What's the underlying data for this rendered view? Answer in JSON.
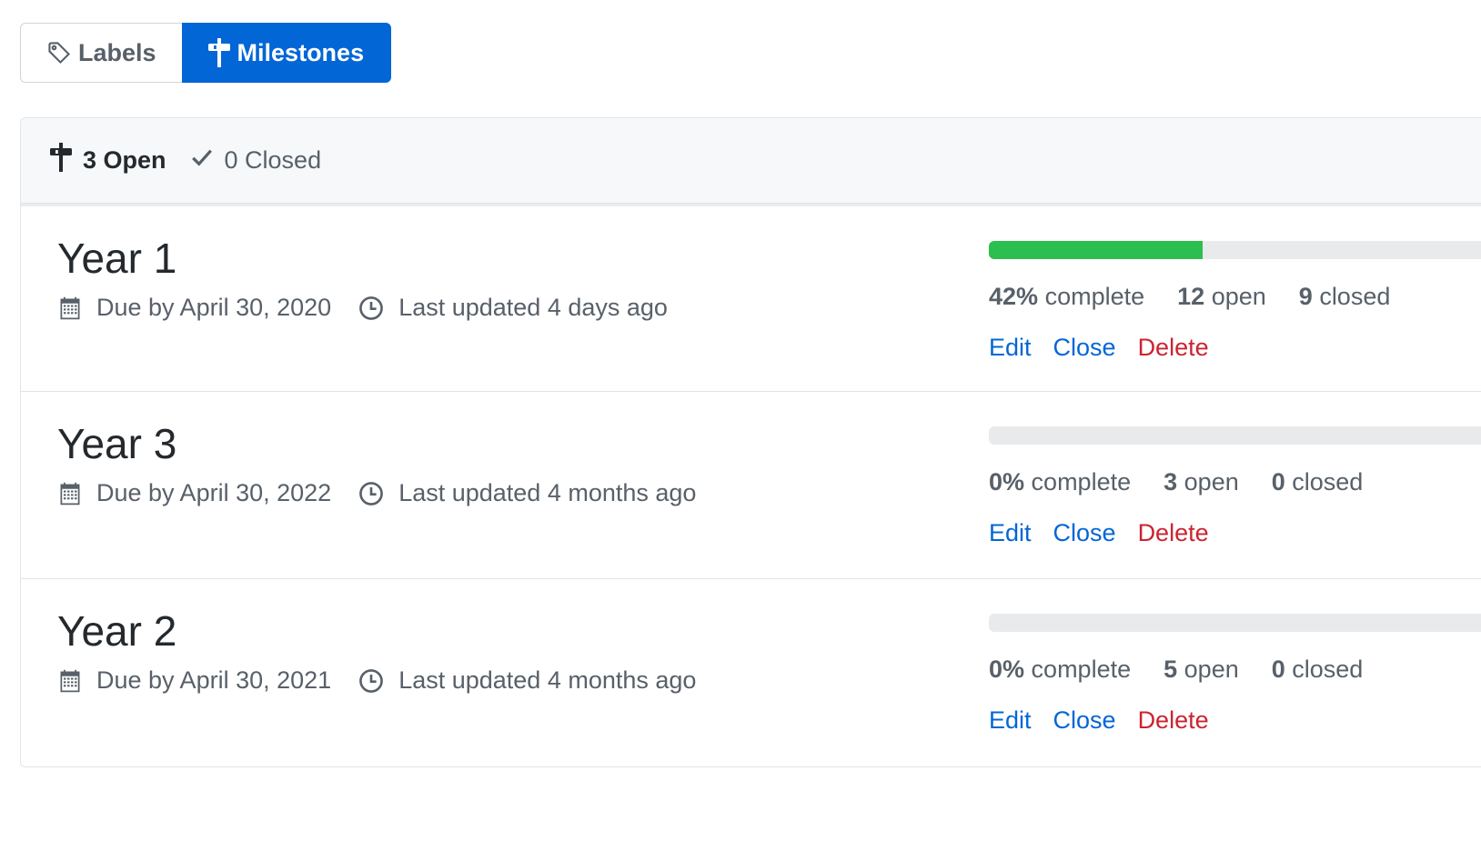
{
  "tabs": {
    "labels": "Labels",
    "milestones": "Milestones"
  },
  "header": {
    "open_label": "3 Open",
    "closed_label": "0 Closed"
  },
  "milestones": [
    {
      "title": "Year 1",
      "due": "Due by April 30, 2020",
      "updated": "Last updated 4 days ago",
      "progress_fraction": 0.42,
      "percent": "42%",
      "complete_label": "complete",
      "open_count": "12",
      "open_label": "open",
      "closed_count": "9",
      "closed_label": "closed",
      "edit": "Edit",
      "close": "Close",
      "delete": "Delete"
    },
    {
      "title": "Year 3",
      "due": "Due by April 30, 2022",
      "updated": "Last updated 4 months ago",
      "progress_fraction": 0,
      "percent": "0%",
      "complete_label": "complete",
      "open_count": "3",
      "open_label": "open",
      "closed_count": "0",
      "closed_label": "closed",
      "edit": "Edit",
      "close": "Close",
      "delete": "Delete"
    },
    {
      "title": "Year 2",
      "due": "Due by April 30, 2021",
      "updated": "Last updated 4 months ago",
      "progress_fraction": 0,
      "percent": "0%",
      "complete_label": "complete",
      "open_count": "5",
      "open_label": "open",
      "closed_count": "0",
      "closed_label": "closed",
      "edit": "Edit",
      "close": "Close",
      "delete": "Delete"
    }
  ],
  "colors": {
    "accent": "#0366d6",
    "progress": "#2cbe4e",
    "danger": "#cb2431"
  },
  "icons": {
    "labels_tab": "tag-icon",
    "milestones_tab": "milestone-icon",
    "open": "milestone-icon",
    "closed": "check-icon",
    "due": "calendar-icon",
    "updated": "clock-icon"
  }
}
